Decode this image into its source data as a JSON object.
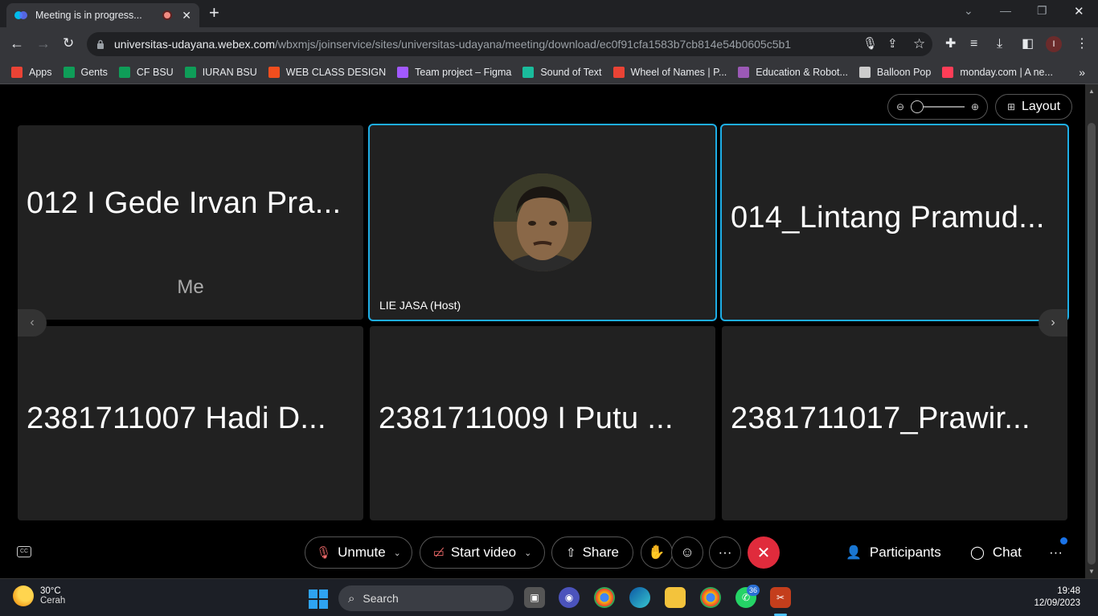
{
  "browser": {
    "tab_title": "Meeting is in progress...",
    "url_host": "universitas-udayana.webex.com",
    "url_path": "/wbxmjs/joinservice/sites/universitas-udayana/meeting/download/ec0f91cfa1583b7cb814e54b0605c5b1",
    "profile_initial": "I",
    "bookmarks": [
      {
        "label": "Apps",
        "color": "#ea4335"
      },
      {
        "label": "Gents",
        "color": "#0f9d58"
      },
      {
        "label": "CF BSU",
        "color": "#0f9d58"
      },
      {
        "label": "IURAN BSU",
        "color": "#0f9d58"
      },
      {
        "label": "WEB CLASS DESIGN",
        "color": "#f24e1e"
      },
      {
        "label": "Team project – Figma",
        "color": "#a259ff"
      },
      {
        "label": "Sound of Text",
        "color": "#1abc9c"
      },
      {
        "label": "Wheel of Names | P...",
        "color": "#ea4335"
      },
      {
        "label": "Education & Robot...",
        "color": "#9b59b6"
      },
      {
        "label": "Balloon Pop",
        "color": "#cccccc"
      },
      {
        "label": "monday.com | A ne...",
        "color": "#ff3d57"
      }
    ]
  },
  "meeting": {
    "layout_label": "Layout",
    "tiles": [
      {
        "name": "012 I Gede Irvan Pra...",
        "sub": "Me"
      },
      {
        "caption": "LIE JASA (Host)"
      },
      {
        "name": "014_Lintang Pramud..."
      },
      {
        "name": "2381711007 Hadi D..."
      },
      {
        "name": "2381711009 I Putu ..."
      },
      {
        "name": "2381711017_Prawir..."
      }
    ],
    "controls": {
      "unmute": "Unmute",
      "start_video": "Start video",
      "share": "Share",
      "participants": "Participants",
      "chat": "Chat"
    }
  },
  "taskbar": {
    "temperature": "30°C",
    "weather": "Cerah",
    "search": "Search",
    "time": "19:48",
    "date": "12/09/2023",
    "whatsapp_badge": "36",
    "accent": "#1eaee6",
    "end_color": "#e02b3c"
  }
}
